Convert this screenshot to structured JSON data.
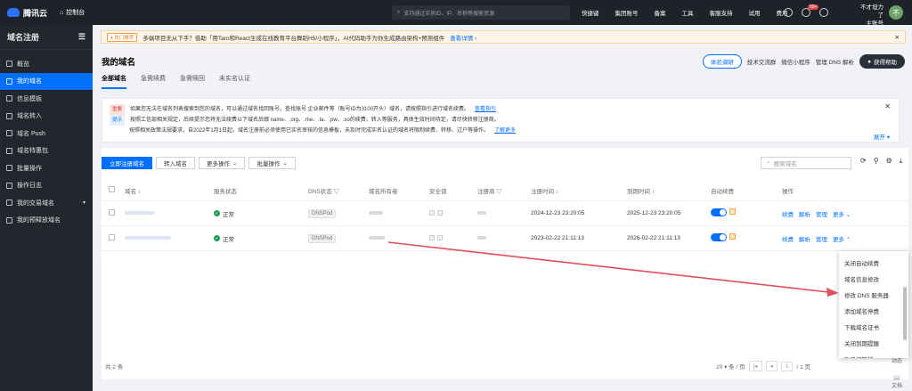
{
  "topbar": {
    "logo": "腾讯云",
    "console": "控制台",
    "search_placeholder": "支持通过实例ID、IP、名称等搜索资源",
    "shortcut": "快捷键",
    "nav": [
      "集团账号",
      "备案",
      "工具",
      "客服支持",
      "试用",
      "费用"
    ],
    "badge": "99+",
    "user_line1": "不才坦力了",
    "user_line2": "主账号",
    "avatar": "不"
  },
  "sidebar": {
    "title": "域名注册",
    "items": [
      "概览",
      "我的域名",
      "信息模板",
      "域名转入",
      "域名 Push",
      "域名特惠包",
      "批量操作",
      "操作日志",
      "我的交易域名",
      "我的预释放域名"
    ]
  },
  "notice": {
    "tag": "♦ 热门推荐",
    "text": "多端项目无从下手？借助「用Taro和React生成在线教育平台舞蹈H5/小程序」，AI代码助手为你生成路由架构+预测组件",
    "link": "查看详情 ›"
  },
  "main": {
    "title": "我的域名",
    "tabs": [
      "全部域名",
      "急需续费",
      "急需赎回",
      "未实名认证"
    ],
    "header_links": [
      "体验调研",
      "技术交流群",
      "微信小程序",
      "管理 DNS 解析",
      "获得帮助"
    ]
  },
  "info": {
    "tag_important": "重要",
    "line1": "如果您无法在域名列表搜索到您的域名，可以通过域名找回账号。查找账号 企业邮件等（账号ID为3100开头）域名，请按照指引进行域名续费。",
    "link1": "查看指引",
    "tag_tip": "提示",
    "line2": "按照工信部相关规定，后续提示您将无法续费以下域名后缀 name、.org、.me、.la、.pw、.so的续费、转入等服务，具体生效时间待定，请尽快转移注册商。",
    "line3": "按照相关政策法规要求，自2022年1月1日起，域名注册前必须使用已实名审核的信息模板，未及时完成实名认证的域名将限制续费、转移、过户等操作。",
    "link3": "了解更多",
    "expand": "展开"
  },
  "toolbar": {
    "register": "立即注册域名",
    "transfer": "转入域名",
    "more": "更多操作",
    "batch": "批量操作",
    "search_placeholder": "搜索域名"
  },
  "table": {
    "headers": [
      "域名",
      "服务状态",
      "DNS状态",
      "域名所有者",
      "安全锁",
      "注册商",
      "注册时间",
      "到期时间",
      "自动续费",
      "操作"
    ],
    "rows": [
      {
        "status": "正常",
        "dns": "DNSPod",
        "reg": "2024-12-23 23:20:05",
        "exp": "2025-12-23 23:20:05"
      },
      {
        "status": "正常",
        "dns": "DNSPod",
        "reg": "2023-02-22 21:11:13",
        "exp": "2026-02-22 21:11:13"
      }
    ],
    "actions": [
      "续费",
      "解析",
      "管理",
      "更多"
    ],
    "total": "共 2 条",
    "page_size": "20 ▾ 条 / 页",
    "page": "1",
    "page_total": "/ 1 页"
  },
  "dropdown": [
    "关闭自动续费",
    "域名信息修改",
    "修改 DNS 服务器",
    "添加域名停费",
    "下载域名证书",
    "关闭到期提醒",
    "账号间转移"
  ],
  "side_float": [
    "动态",
    "文档"
  ],
  "colors": {
    "accent": "#006eff",
    "success": "#1c9e59",
    "arrow": "#e0505a"
  }
}
